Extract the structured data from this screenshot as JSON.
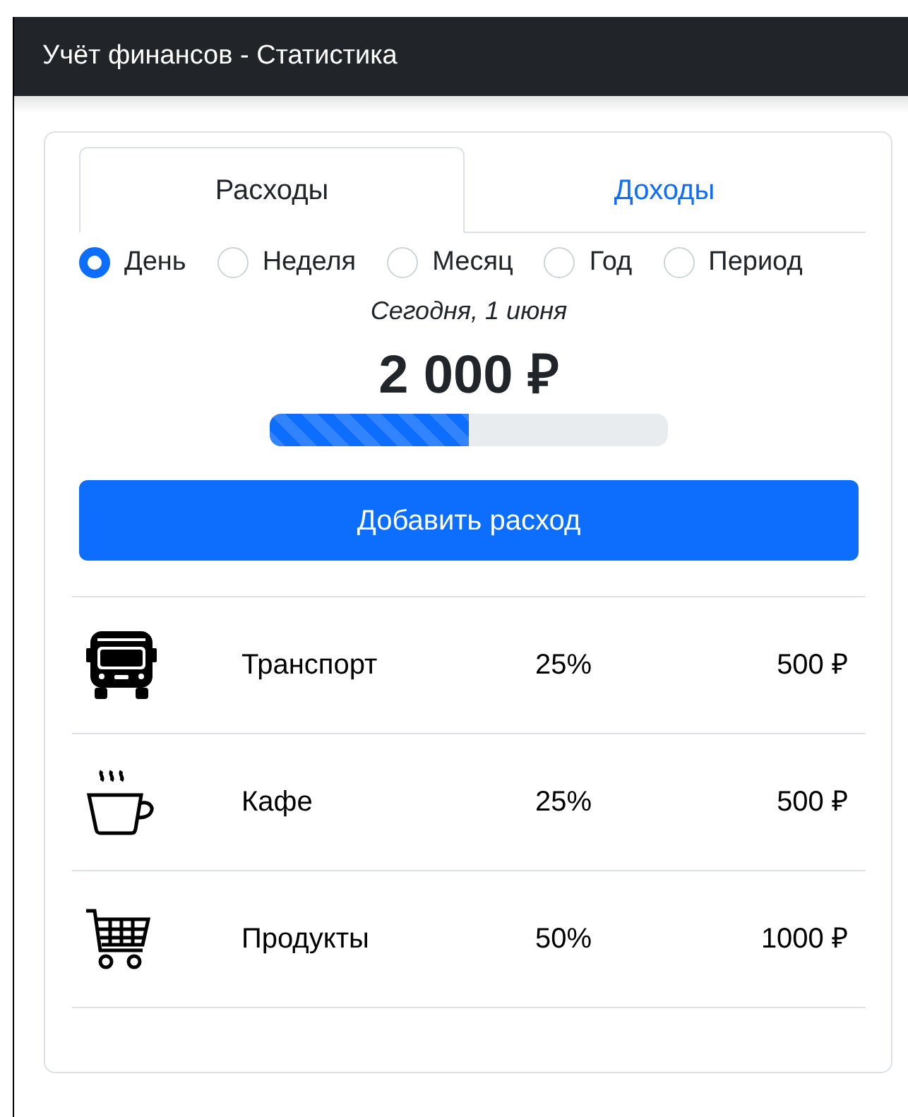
{
  "header": {
    "title": "Учёт финансов - Статистика"
  },
  "tabs": [
    {
      "label": "Расходы",
      "selected": true
    },
    {
      "label": "Доходы",
      "selected": false
    }
  ],
  "periods": [
    {
      "label": "День",
      "selected": true
    },
    {
      "label": "Неделя",
      "selected": false
    },
    {
      "label": "Месяц",
      "selected": false
    },
    {
      "label": "Год",
      "selected": false
    },
    {
      "label": "Период",
      "selected": false
    }
  ],
  "date": "Сегодня, 1 июня",
  "total": "2 000 ₽",
  "progress": {
    "level": 0.5
  },
  "add_button": "Добавить расход",
  "categories": [
    {
      "kind": "bus",
      "name": "Транспорт",
      "percent": "25%",
      "amount": "500 ₽"
    },
    {
      "kind": "cup",
      "name": "Кафе",
      "percent": "25%",
      "amount": "500 ₽"
    },
    {
      "kind": "cart",
      "name": "Продукты",
      "percent": "50%",
      "amount": "1000 ₽"
    }
  ]
}
